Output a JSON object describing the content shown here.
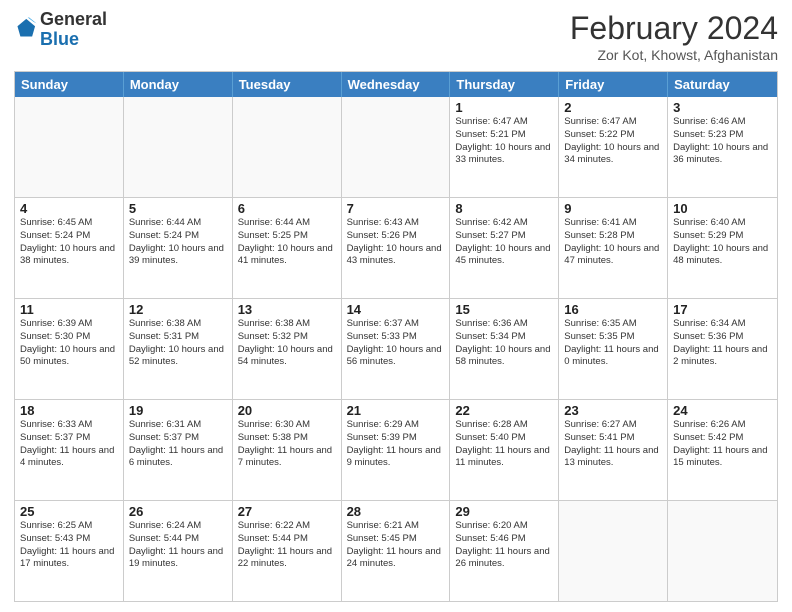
{
  "header": {
    "logo_general": "General",
    "logo_blue": "Blue",
    "month_title": "February 2024",
    "location": "Zor Kot, Khowst, Afghanistan"
  },
  "days_of_week": [
    "Sunday",
    "Monday",
    "Tuesday",
    "Wednesday",
    "Thursday",
    "Friday",
    "Saturday"
  ],
  "weeks": [
    [
      {
        "day": "",
        "empty": true
      },
      {
        "day": "",
        "empty": true
      },
      {
        "day": "",
        "empty": true
      },
      {
        "day": "",
        "empty": true
      },
      {
        "day": "1",
        "sunrise": "6:47 AM",
        "sunset": "5:21 PM",
        "daylight": "10 hours and 33 minutes."
      },
      {
        "day": "2",
        "sunrise": "6:47 AM",
        "sunset": "5:22 PM",
        "daylight": "10 hours and 34 minutes."
      },
      {
        "day": "3",
        "sunrise": "6:46 AM",
        "sunset": "5:23 PM",
        "daylight": "10 hours and 36 minutes."
      }
    ],
    [
      {
        "day": "4",
        "sunrise": "6:45 AM",
        "sunset": "5:24 PM",
        "daylight": "10 hours and 38 minutes."
      },
      {
        "day": "5",
        "sunrise": "6:44 AM",
        "sunset": "5:24 PM",
        "daylight": "10 hours and 39 minutes."
      },
      {
        "day": "6",
        "sunrise": "6:44 AM",
        "sunset": "5:25 PM",
        "daylight": "10 hours and 41 minutes."
      },
      {
        "day": "7",
        "sunrise": "6:43 AM",
        "sunset": "5:26 PM",
        "daylight": "10 hours and 43 minutes."
      },
      {
        "day": "8",
        "sunrise": "6:42 AM",
        "sunset": "5:27 PM",
        "daylight": "10 hours and 45 minutes."
      },
      {
        "day": "9",
        "sunrise": "6:41 AM",
        "sunset": "5:28 PM",
        "daylight": "10 hours and 47 minutes."
      },
      {
        "day": "10",
        "sunrise": "6:40 AM",
        "sunset": "5:29 PM",
        "daylight": "10 hours and 48 minutes."
      }
    ],
    [
      {
        "day": "11",
        "sunrise": "6:39 AM",
        "sunset": "5:30 PM",
        "daylight": "10 hours and 50 minutes."
      },
      {
        "day": "12",
        "sunrise": "6:38 AM",
        "sunset": "5:31 PM",
        "daylight": "10 hours and 52 minutes."
      },
      {
        "day": "13",
        "sunrise": "6:38 AM",
        "sunset": "5:32 PM",
        "daylight": "10 hours and 54 minutes."
      },
      {
        "day": "14",
        "sunrise": "6:37 AM",
        "sunset": "5:33 PM",
        "daylight": "10 hours and 56 minutes."
      },
      {
        "day": "15",
        "sunrise": "6:36 AM",
        "sunset": "5:34 PM",
        "daylight": "10 hours and 58 minutes."
      },
      {
        "day": "16",
        "sunrise": "6:35 AM",
        "sunset": "5:35 PM",
        "daylight": "11 hours and 0 minutes."
      },
      {
        "day": "17",
        "sunrise": "6:34 AM",
        "sunset": "5:36 PM",
        "daylight": "11 hours and 2 minutes."
      }
    ],
    [
      {
        "day": "18",
        "sunrise": "6:33 AM",
        "sunset": "5:37 PM",
        "daylight": "11 hours and 4 minutes."
      },
      {
        "day": "19",
        "sunrise": "6:31 AM",
        "sunset": "5:37 PM",
        "daylight": "11 hours and 6 minutes."
      },
      {
        "day": "20",
        "sunrise": "6:30 AM",
        "sunset": "5:38 PM",
        "daylight": "11 hours and 7 minutes."
      },
      {
        "day": "21",
        "sunrise": "6:29 AM",
        "sunset": "5:39 PM",
        "daylight": "11 hours and 9 minutes."
      },
      {
        "day": "22",
        "sunrise": "6:28 AM",
        "sunset": "5:40 PM",
        "daylight": "11 hours and 11 minutes."
      },
      {
        "day": "23",
        "sunrise": "6:27 AM",
        "sunset": "5:41 PM",
        "daylight": "11 hours and 13 minutes."
      },
      {
        "day": "24",
        "sunrise": "6:26 AM",
        "sunset": "5:42 PM",
        "daylight": "11 hours and 15 minutes."
      }
    ],
    [
      {
        "day": "25",
        "sunrise": "6:25 AM",
        "sunset": "5:43 PM",
        "daylight": "11 hours and 17 minutes."
      },
      {
        "day": "26",
        "sunrise": "6:24 AM",
        "sunset": "5:44 PM",
        "daylight": "11 hours and 19 minutes."
      },
      {
        "day": "27",
        "sunrise": "6:22 AM",
        "sunset": "5:44 PM",
        "daylight": "11 hours and 22 minutes."
      },
      {
        "day": "28",
        "sunrise": "6:21 AM",
        "sunset": "5:45 PM",
        "daylight": "11 hours and 24 minutes."
      },
      {
        "day": "29",
        "sunrise": "6:20 AM",
        "sunset": "5:46 PM",
        "daylight": "11 hours and 26 minutes."
      },
      {
        "day": "",
        "empty": true
      },
      {
        "day": "",
        "empty": true
      }
    ]
  ]
}
